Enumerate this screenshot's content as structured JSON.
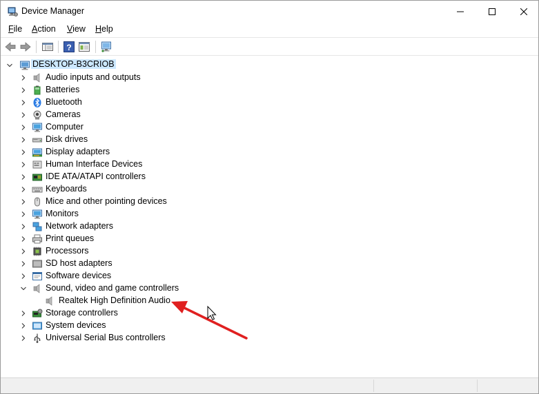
{
  "window": {
    "title": "Device Manager"
  },
  "menu": {
    "items": [
      {
        "label": "File",
        "mnemonic": "F",
        "rest": "ile"
      },
      {
        "label": "Action",
        "mnemonic": "A",
        "rest": "ction"
      },
      {
        "label": "View",
        "mnemonic": "V",
        "rest": "iew"
      },
      {
        "label": "Help",
        "mnemonic": "H",
        "rest": "elp"
      }
    ]
  },
  "toolbar": {
    "buttons": [
      "back-icon",
      "forward-icon",
      "show-hide-console-tree-icon",
      "help-icon",
      "properties-icon",
      "scan-hardware-icon"
    ]
  },
  "tree": {
    "root": {
      "label": "DESKTOP-B3CRIOB",
      "icon": "computer-icon",
      "expanded": true
    },
    "categories": [
      {
        "label": "Audio inputs and outputs",
        "icon": "speaker-icon",
        "expanded": false
      },
      {
        "label": "Batteries",
        "icon": "battery-icon",
        "expanded": false
      },
      {
        "label": "Bluetooth",
        "icon": "bluetooth-icon",
        "expanded": false
      },
      {
        "label": "Cameras",
        "icon": "camera-icon",
        "expanded": false
      },
      {
        "label": "Computer",
        "icon": "monitor-icon",
        "expanded": false
      },
      {
        "label": "Disk drives",
        "icon": "disk-drive-icon",
        "expanded": false
      },
      {
        "label": "Display adapters",
        "icon": "display-adapter-icon",
        "expanded": false
      },
      {
        "label": "Human Interface Devices",
        "icon": "hid-icon",
        "expanded": false
      },
      {
        "label": "IDE ATA/ATAPI controllers",
        "icon": "ide-controller-icon",
        "expanded": false
      },
      {
        "label": "Keyboards",
        "icon": "keyboard-icon",
        "expanded": false
      },
      {
        "label": "Mice and other pointing devices",
        "icon": "mouse-icon",
        "expanded": false
      },
      {
        "label": "Monitors",
        "icon": "monitor-icon",
        "expanded": false
      },
      {
        "label": "Network adapters",
        "icon": "network-adapter-icon",
        "expanded": false
      },
      {
        "label": "Print queues",
        "icon": "printer-icon",
        "expanded": false
      },
      {
        "label": "Processors",
        "icon": "processor-icon",
        "expanded": false
      },
      {
        "label": "SD host adapters",
        "icon": "sd-card-icon",
        "expanded": false
      },
      {
        "label": "Software devices",
        "icon": "software-device-icon",
        "expanded": false
      },
      {
        "label": "Sound, video and game controllers",
        "icon": "speaker-icon",
        "expanded": true
      },
      {
        "label": "Realtek High Definition Audio",
        "icon": "speaker-icon",
        "child": true
      },
      {
        "label": "Storage controllers",
        "icon": "storage-controller-icon",
        "expanded": false
      },
      {
        "label": "System devices",
        "icon": "system-device-icon",
        "expanded": false
      },
      {
        "label": "Universal Serial Bus controllers",
        "icon": "usb-icon",
        "expanded": false
      }
    ]
  },
  "colors": {
    "selection": "#cce8ff",
    "arrow": "#e02020"
  }
}
